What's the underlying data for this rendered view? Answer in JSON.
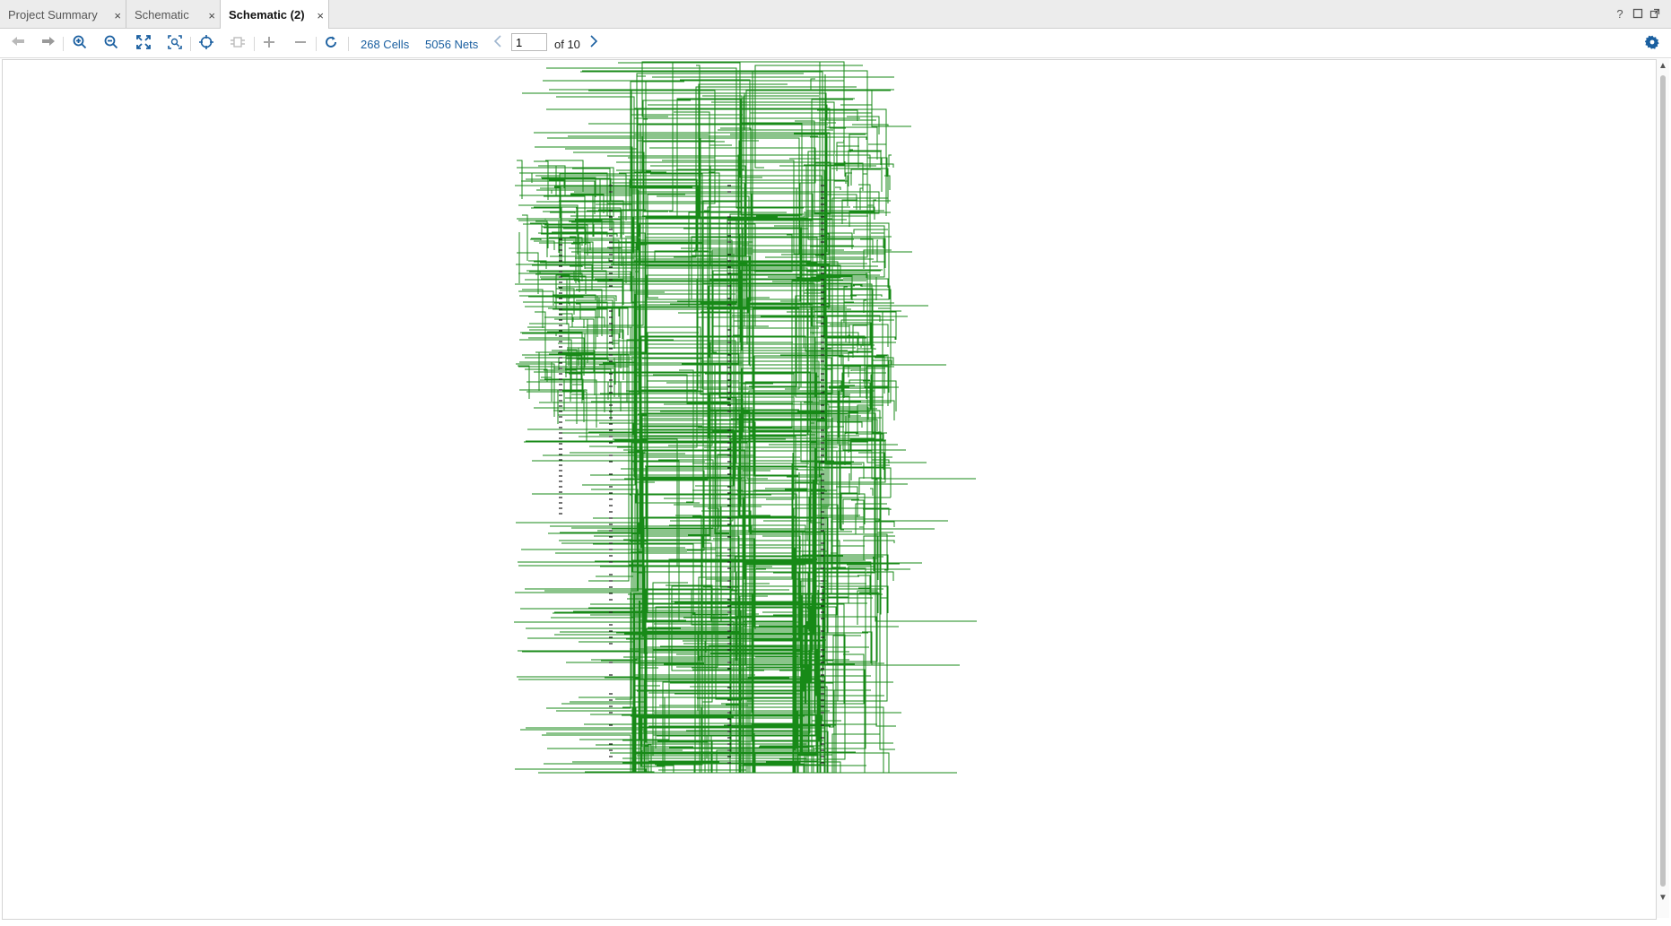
{
  "tabs": [
    {
      "label": "Project Summary",
      "active": false
    },
    {
      "label": "Schematic",
      "active": false
    },
    {
      "label": "Schematic (2)",
      "active": true
    }
  ],
  "window_controls": {
    "help": "?",
    "maximize": "□",
    "float": "⧉"
  },
  "toolbar": {
    "cells_label": "268 Cells",
    "nets_label": "5056 Nets",
    "page_value": "1",
    "page_total": "of 10"
  },
  "icons": {
    "back": "arrow-left-icon",
    "forward": "arrow-right-icon",
    "zoom_in": "zoom-in-icon",
    "zoom_out": "zoom-out-icon",
    "zoom_fit": "zoom-fit-icon",
    "zoom_area": "zoom-area-icon",
    "select": "crosshair-icon",
    "route": "route-icon",
    "expand": "plus-icon",
    "collapse": "minus-icon",
    "refresh": "refresh-icon",
    "settings": "gear-icon"
  },
  "colors": {
    "wire": "#178a17",
    "link": "#1a5fa0",
    "accent": "#1a5fa0"
  }
}
